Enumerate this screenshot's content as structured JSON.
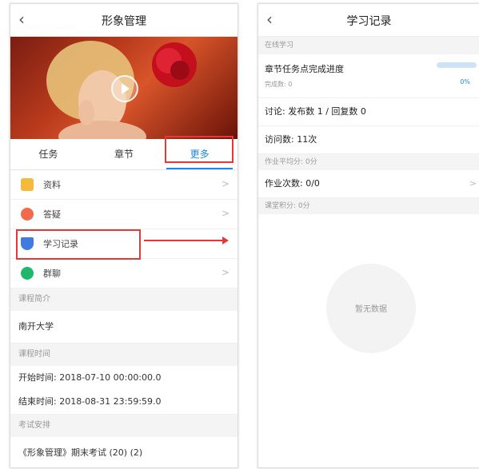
{
  "left": {
    "title": "形象管理",
    "tabs": [
      "任务",
      "章节",
      "更多"
    ],
    "menu": [
      {
        "label": "资料",
        "icon": "document-icon",
        "color": "#f5b93b",
        "chevron": true
      },
      {
        "label": "答疑",
        "icon": "question-icon",
        "color": "#f26a4b",
        "chevron": true
      },
      {
        "label": "学习记录",
        "icon": "study-record-icon",
        "color": "#3f7be0",
        "chevron": false
      },
      {
        "label": "群聊",
        "icon": "chat-icon",
        "color": "#1fb86a",
        "chevron": true
      }
    ],
    "course_intro_head": "课程简介",
    "school": "南开大学",
    "course_time_head": "课程时间",
    "start_time": "开始时间: 2018-07-10 00:00:00.0",
    "end_time": "结束时间: 2018-08-31 23:59:59.0",
    "exam_head": "考试安排",
    "exam_item": "《形象管理》期末考试 (20) (2)"
  },
  "right": {
    "title": "学习记录",
    "online_head": "在线学习",
    "chapter_progress_label": "章节任务点完成进度",
    "completed_count": "完成数: 0",
    "progress_percent": "0%",
    "progress_value": 0,
    "discussion": "讨论: 发布数 1 / 回复数 0",
    "visits": "访问数: 11次",
    "homework_avg": "作业平均分: 0分",
    "homework_count": "作业次数: 0/0",
    "class_points": "课堂积分: 0分",
    "empty_text": "暂无数据"
  },
  "colors": {
    "accent": "#1e88e5",
    "highlight": "#e23a3a"
  }
}
